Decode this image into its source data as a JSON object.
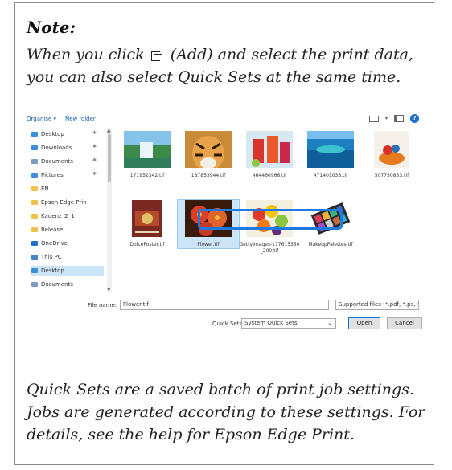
{
  "note": {
    "title": "Note:",
    "line1_before": "When you click",
    "line1_after": "(Add) and select the print data,",
    "line2": "you can also select Quick Sets at the same time.",
    "footer": "Quick Sets are a saved batch of print job settings. Jobs are generated according to these settings. For details, see the help for Epson Edge Print."
  },
  "dialog": {
    "toolbar": {
      "organise": "Organise ▾",
      "new_folder": "New folder"
    },
    "nav_items": [
      {
        "label": "Desktop",
        "icon_color": "#3c8fdc",
        "pinned": true
      },
      {
        "label": "Downloads",
        "icon_color": "#3c8fdc",
        "pinned": true
      },
      {
        "label": "Documents",
        "icon_color": "#7a9cc6",
        "pinned": true
      },
      {
        "label": "Pictures",
        "icon_color": "#3c8fdc",
        "pinned": true
      },
      {
        "label": "EN",
        "icon_color": "#f0c44c",
        "pinned": false
      },
      {
        "label": "Epson Edge Prin",
        "icon_color": "#f0c44c",
        "pinned": false
      },
      {
        "label": "Kadenz_2_1",
        "icon_color": "#f0c44c",
        "pinned": false
      },
      {
        "label": "Release",
        "icon_color": "#f0c44c",
        "pinned": false
      },
      {
        "label": "OneDrive",
        "icon_color": "#1f6fce",
        "pinned": false
      },
      {
        "label": "This PC",
        "icon_color": "#4a87c5",
        "pinned": false
      },
      {
        "label": "Desktop",
        "icon_color": "#3c8fdc",
        "pinned": false,
        "selected": true
      },
      {
        "label": "Documents",
        "icon_color": "#7a9cc6",
        "pinned": false
      }
    ],
    "files": [
      {
        "name": "171952342.tif",
        "thumb": "waterfall"
      },
      {
        "name": "187853944.tif",
        "thumb": "tiger"
      },
      {
        "name": "464460966.tif",
        "thumb": "drinks"
      },
      {
        "name": "471401038.tif",
        "thumb": "ocean"
      },
      {
        "name": "507750853.tif",
        "thumb": "dessert"
      },
      {
        "name": "DolcePoster.tif",
        "thumb": "poster"
      },
      {
        "name": "Flower.tif",
        "thumb": "flower",
        "selected": true
      },
      {
        "name": "GettyImages-177615350_200.tif",
        "thumb": "fruit"
      },
      {
        "name": "MakeupPalettes.tif",
        "thumb": "palette"
      }
    ],
    "file_name_label": "File name:",
    "file_name_value": "Flower.tif",
    "file_type_value": "Supported files (*.pdf, *.ps, *.ep",
    "quick_sets_label": "Quick Sets:",
    "quick_sets_value": "System Quick Sets",
    "open_label": "Open",
    "cancel_label": "Cancel"
  }
}
